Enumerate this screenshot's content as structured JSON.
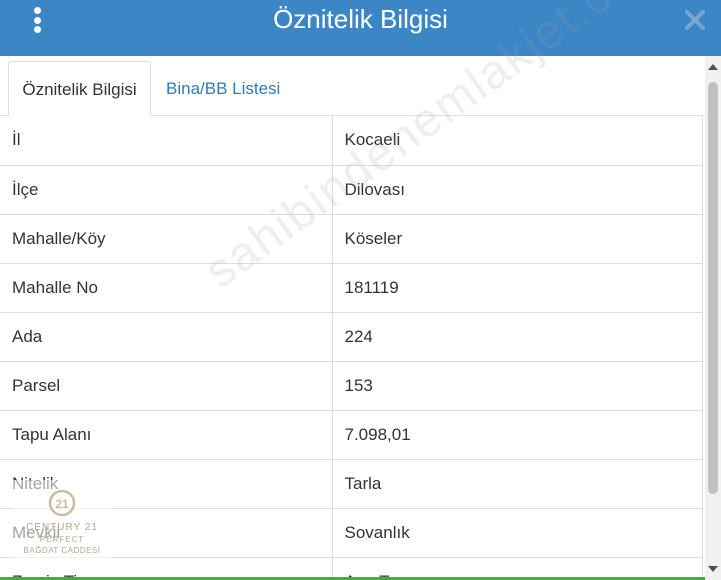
{
  "header": {
    "title": "Öznitelik Bilgisi",
    "background": "#3c86c6"
  },
  "tabs": [
    {
      "label": "Öznitelik Bilgisi",
      "active": true
    },
    {
      "label": "Bina/BB Listesi",
      "active": false
    }
  ],
  "rows": [
    {
      "key": "İl",
      "value": "Kocaeli"
    },
    {
      "key": "İlçe",
      "value": "Dilovası"
    },
    {
      "key": "Mahalle/Köy",
      "value": "Köseler"
    },
    {
      "key": "Mahalle No",
      "value": "181119"
    },
    {
      "key": "Ada",
      "value": "224"
    },
    {
      "key": "Parsel",
      "value": "153"
    },
    {
      "key": "Tapu Alanı",
      "value": "7.098,01"
    },
    {
      "key": "Nitelik",
      "value": "Tarla"
    },
    {
      "key": "Mevkii",
      "value": "Sovanlık"
    },
    {
      "key": "Zemin Tip",
      "value": "Ana Taşınmaz"
    }
  ],
  "watermark": {
    "text": "sahibindenemlakjet.com"
  },
  "logo": {
    "number": "21",
    "line1": "CENTURY 21",
    "line2": "PERFECT",
    "line3": "BAĞDAT CADDESİ"
  },
  "icons": {
    "menu": "vertical-dots-icon",
    "close": "close-icon"
  },
  "colors": {
    "tab_link": "#337ab7",
    "accent_bottom": "#3fae3f"
  }
}
